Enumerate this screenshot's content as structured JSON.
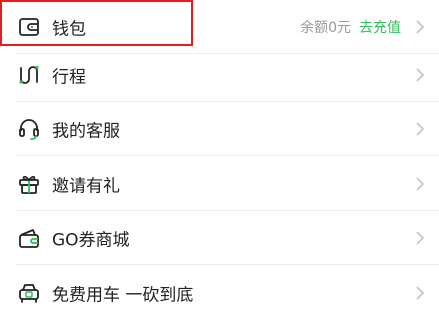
{
  "menu": {
    "items": [
      {
        "id": "wallet",
        "label": "钱包",
        "icon": "wallet-icon",
        "balance": "余额0元",
        "action": "去充值"
      },
      {
        "id": "trips",
        "label": "行程",
        "icon": "route-icon"
      },
      {
        "id": "customer-service",
        "label": "我的客服",
        "icon": "headset-icon"
      },
      {
        "id": "invite",
        "label": "邀请有礼",
        "icon": "gift-icon"
      },
      {
        "id": "coupon-mall",
        "label": "GO券商城",
        "icon": "coupon-wallet-icon"
      },
      {
        "id": "free-ride",
        "label": "免费用车 一砍到底",
        "icon": "car-icon"
      }
    ]
  },
  "colors": {
    "accent_green": "#2fbf59",
    "highlight_red": "#e0201f",
    "text": "#222222",
    "secondary_text": "#999999"
  }
}
